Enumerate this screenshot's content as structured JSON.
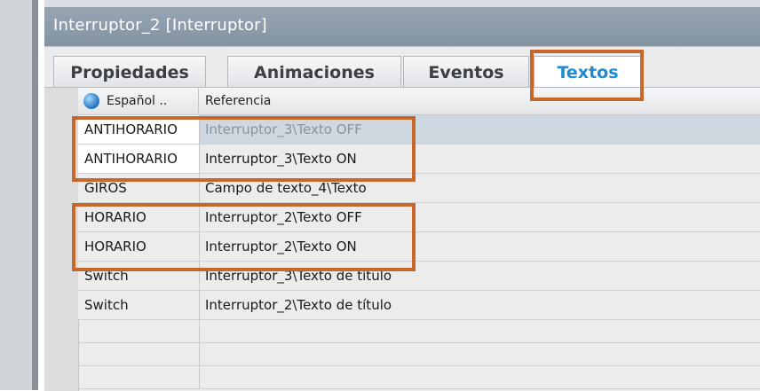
{
  "window": {
    "title": "Interruptor_2 [Interruptor]"
  },
  "tabs": [
    {
      "label": "Propiedades",
      "active": false
    },
    {
      "label": "Animaciones",
      "active": false
    },
    {
      "label": "Eventos",
      "active": false
    },
    {
      "label": "Textos",
      "active": true
    }
  ],
  "table": {
    "columns": [
      "Español ..",
      "Referencia"
    ],
    "rows": [
      {
        "text": "ANTIHORARIO",
        "reference": "Interruptor_3\\Texto OFF"
      },
      {
        "text": "ANTIHORARIO",
        "reference": "Interruptor_3\\Texto ON"
      },
      {
        "text": "GIROS",
        "reference": "Campo de texto_4\\Texto"
      },
      {
        "text": "HORARIO",
        "reference": "Interruptor_2\\Texto OFF"
      },
      {
        "text": "HORARIO",
        "reference": "Interruptor_2\\Texto ON"
      },
      {
        "text": "Switch",
        "reference": "Interruptor_3\\Texto de título"
      },
      {
        "text": "Switch",
        "reference": "Interruptor_2\\Texto de título"
      }
    ]
  },
  "colors": {
    "highlight": "#c8672a",
    "active_tab_text": "#1f8bd1",
    "title_bar": "#8f9dac"
  }
}
